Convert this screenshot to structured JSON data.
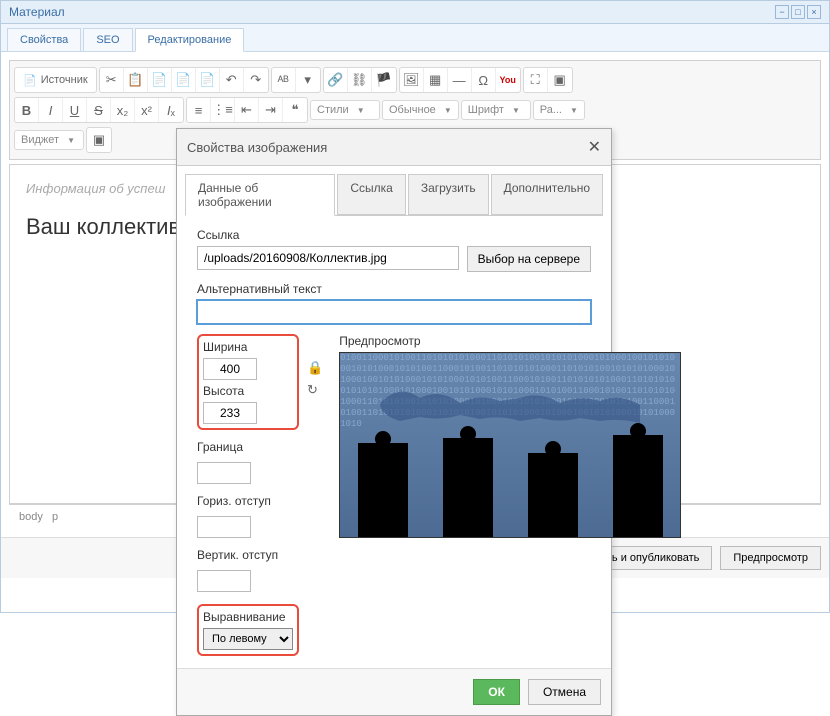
{
  "window": {
    "title": "Материал"
  },
  "tabs": {
    "properties": "Свойства",
    "seo": "SEO",
    "edit": "Редактирование"
  },
  "toolbar": {
    "source": "Источник",
    "styles": "Стили",
    "format": "Обычное",
    "font": "Шрифт",
    "size": "Ра...",
    "widget": "Виджет"
  },
  "editor": {
    "line1": "Информация об успеш",
    "line2": "Ваш коллектив:"
  },
  "status": {
    "body": "body",
    "p": "p"
  },
  "actions": {
    "publish": "нить и опубликовать",
    "preview": "Предпросмотр"
  },
  "dialog": {
    "title": "Свойства изображения",
    "tabs": {
      "data": "Данные об изображении",
      "link": "Ссылка",
      "upload": "Загрузить",
      "advanced": "Дополнительно"
    },
    "url_label": "Ссылка",
    "url_value": "/uploads/20160908/Коллектив.jpg",
    "server_btn": "Выбор на сервере",
    "alt_label": "Альтернативный текст",
    "alt_value": "",
    "width_label": "Ширина",
    "width_value": "400",
    "height_label": "Высота",
    "height_value": "233",
    "border_label": "Граница",
    "border_value": "",
    "hspace_label": "Гориз. отступ",
    "hspace_value": "",
    "vspace_label": "Вертик. отступ",
    "vspace_value": "",
    "align_label": "Выравнивание",
    "align_value": "По левому",
    "preview_label": "Предпросмотр",
    "ok": "ОК",
    "cancel": "Отмена"
  }
}
